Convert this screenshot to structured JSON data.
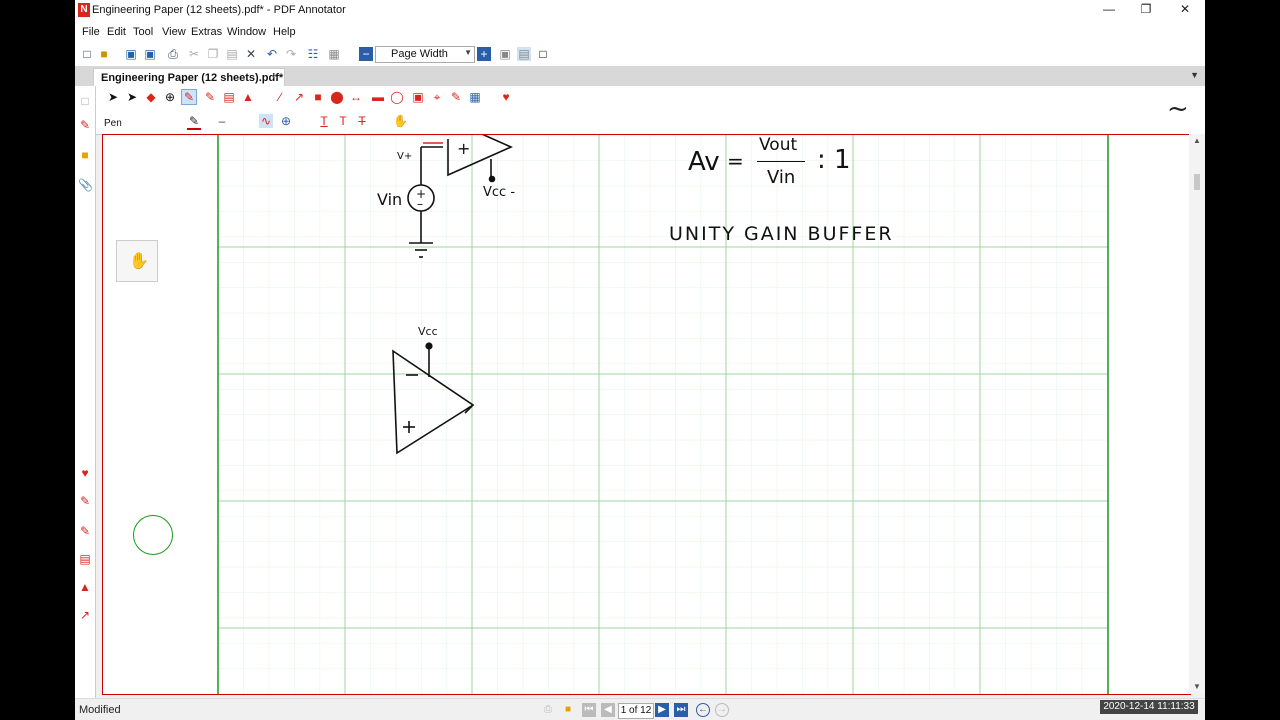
{
  "window": {
    "title": "Engineering Paper (12 sheets).pdf* - PDF Annotator",
    "minimize": "—",
    "maximize": "❐",
    "close": "✕"
  },
  "menu": [
    "File",
    "Edit",
    "Tool",
    "View",
    "Extras",
    "Window",
    "Help"
  ],
  "toolbar": {
    "zoom_value": "Page Width"
  },
  "tab": {
    "label": "Engineering Paper (12 sheets).pdf*",
    "close": "×"
  },
  "tool": {
    "name": "Pen",
    "text_tools": [
      "T",
      "T",
      "T"
    ]
  },
  "side_wave": "~",
  "drawing": {
    "vin_label": "Vin",
    "vplus_label": "V+",
    "vcc_minus_label": "Vcc -",
    "vcc_label": "Vcc",
    "plus_sign": "+",
    "minus_sign": "–",
    "formula_av": "Av",
    "formula_eq": "=",
    "formula_num": "Vout",
    "formula_den": "Vin",
    "formula_ratio": ": 1",
    "heading": "UNITY GAIN BUFFER"
  },
  "status": {
    "text": "Modified",
    "page_indicator": "1 of 12",
    "clock": "2020-12-14  11:11:33"
  },
  "colors": {
    "accent_red": "#d9261c",
    "grid_major": "#9fd49f",
    "grid_minor": "#e4f2e4",
    "margin_green": "#1b9a1b",
    "nav_blue": "#2a5fa8"
  }
}
